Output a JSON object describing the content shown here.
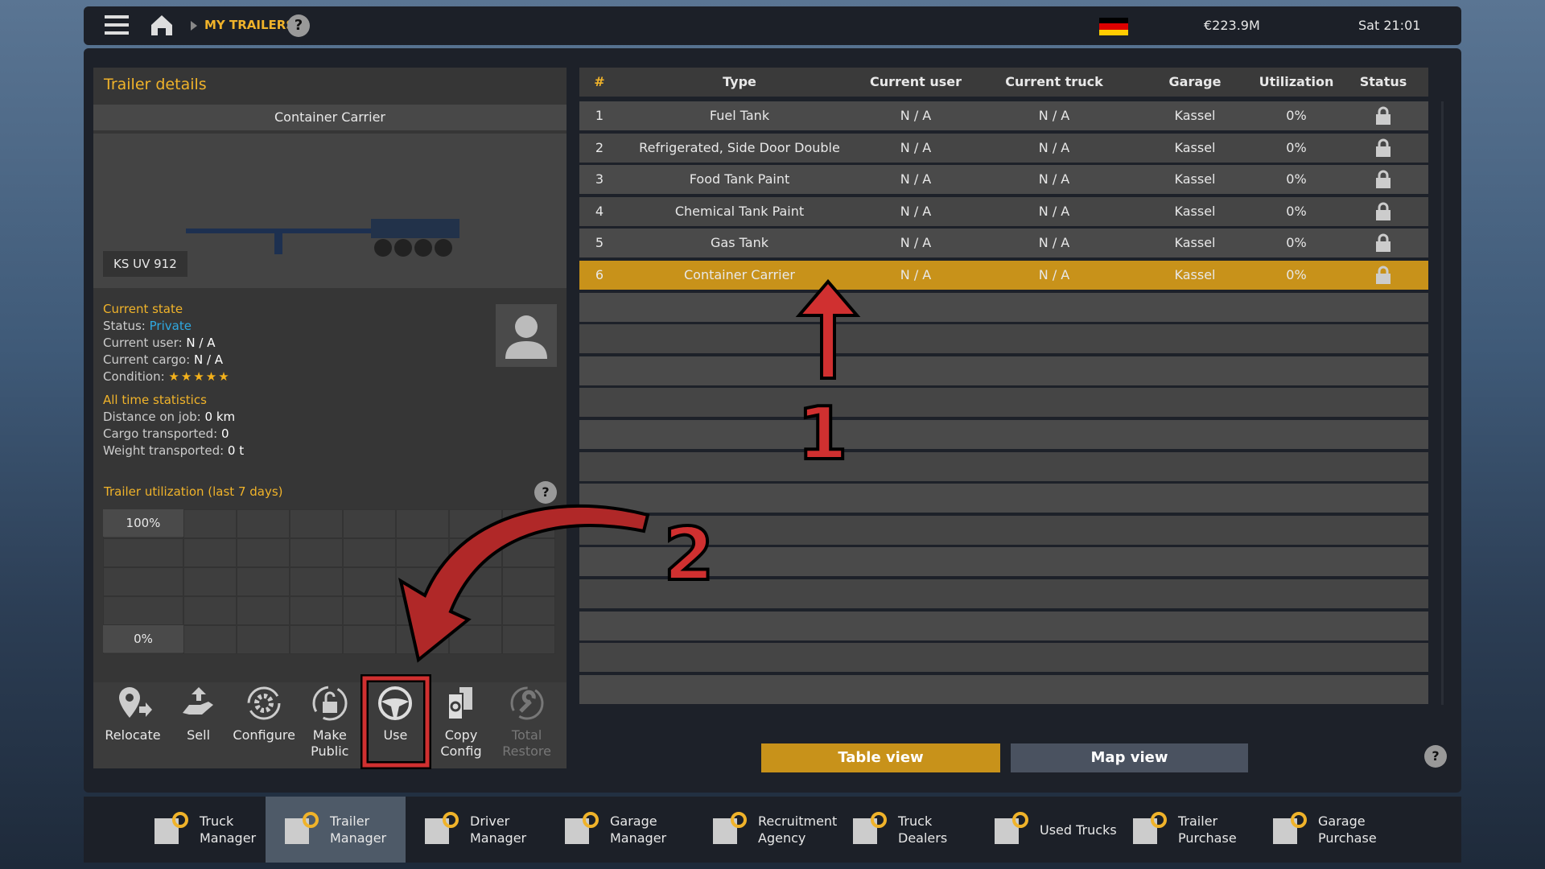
{
  "topbar": {
    "breadcrumb": "MY TRAILERS",
    "money": "€223.9M",
    "time": "Sat 21:01",
    "icons": [
      "menu-icon",
      "home-icon",
      "help-icon",
      "germany-flag"
    ]
  },
  "details": {
    "title": "Trailer details",
    "trailer_name": "Container Carrier",
    "plate": "KS UV 912",
    "current_state": "Current state",
    "status_label": "Status:",
    "status_value": "Private",
    "status_color": "#2fa8e0",
    "user_label": "Current user:",
    "user_value": "N / A",
    "cargo_label": "Current cargo:",
    "cargo_value": "N / A",
    "condition_label": "Condition:",
    "condition_stars": 5,
    "stats_title": "All time statistics",
    "distance_label": "Distance on job:",
    "distance_value": "0 km",
    "cargo_tr_label": "Cargo transported:",
    "cargo_tr_value": "0",
    "weight_label": "Weight transported:",
    "weight_value": "0 t",
    "util_title": "Trailer utilization (last 7 days)",
    "util_max": "100%",
    "util_min": "0%",
    "util_values": [
      0,
      0,
      0,
      0,
      0,
      0,
      0
    ]
  },
  "actions": [
    {
      "label": "Relocate",
      "icon": "relocate-icon"
    },
    {
      "label": "Sell",
      "icon": "sell-icon"
    },
    {
      "label": "Configure",
      "icon": "configure-icon"
    },
    {
      "label": "Make\nPublic",
      "icon": "unlock-icon"
    },
    {
      "label": "Use",
      "icon": "steering-wheel-icon"
    },
    {
      "label": "Copy\nConfig",
      "icon": "copy-config-icon"
    },
    {
      "label": "Total\nRestore",
      "icon": "restore-icon",
      "disabled": true
    }
  ],
  "table": {
    "headers": [
      "#",
      "Type",
      "Current user",
      "Current truck",
      "Garage",
      "Utilization",
      "Status"
    ],
    "rows": [
      [
        "1",
        "Fuel Tank",
        "N / A",
        "N / A",
        "Kassel",
        "0%",
        "lock"
      ],
      [
        "2",
        "Refrigerated, Side Door Double",
        "N / A",
        "N / A",
        "Kassel",
        "0%",
        "lock"
      ],
      [
        "3",
        "Food Tank Paint",
        "N / A",
        "N / A",
        "Kassel",
        "0%",
        "lock"
      ],
      [
        "4",
        "Chemical Tank Paint",
        "N / A",
        "N / A",
        "Kassel",
        "0%",
        "lock"
      ],
      [
        "5",
        "Gas Tank",
        "N / A",
        "N / A",
        "Kassel",
        "0%",
        "lock"
      ],
      [
        "6",
        "Container Carrier",
        "N / A",
        "N / A",
        "Kassel",
        "0%",
        "lock"
      ]
    ],
    "selected_row": 6
  },
  "views": {
    "table": "Table view",
    "map": "Map view",
    "active": "table"
  },
  "annotations": {
    "one": "1",
    "two": "2"
  },
  "nav": [
    {
      "line1": "Truck",
      "line2": "Manager"
    },
    {
      "line1": "Trailer",
      "line2": "Manager",
      "active": true
    },
    {
      "line1": "Driver",
      "line2": "Manager"
    },
    {
      "line1": "Garage",
      "line2": "Manager"
    },
    {
      "line1": "Recruitment",
      "line2": "Agency"
    },
    {
      "line1": "Truck",
      "line2": "Dealers"
    },
    {
      "line1": "Used Trucks",
      "line2": ""
    },
    {
      "line1": "Trailer",
      "line2": "Purchase"
    },
    {
      "line1": "Garage",
      "line2": "Purchase"
    }
  ],
  "colors": {
    "accent": "#f0b32a",
    "selected_row": "#c8921a",
    "annotation": "#d03030"
  }
}
